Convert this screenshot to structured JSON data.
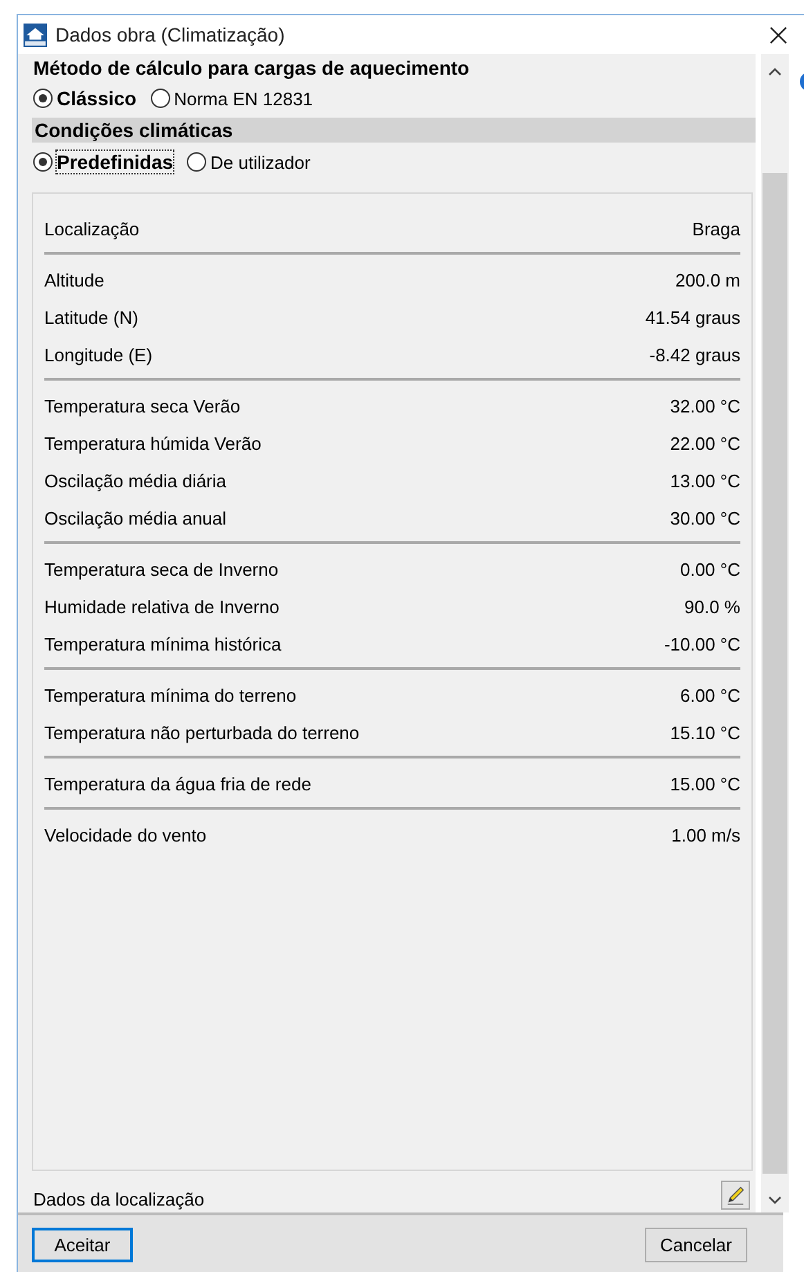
{
  "window": {
    "title": "Dados obra (Climatização)"
  },
  "heating_method": {
    "title": "Método de cálculo para cargas de aquecimento",
    "options": [
      {
        "label": "Clássico",
        "selected": true
      },
      {
        "label": "Norma EN 12831",
        "selected": false
      }
    ]
  },
  "climate": {
    "title": "Condições climáticas",
    "options": [
      {
        "label": "Predefinidas",
        "selected": true
      },
      {
        "label": "De utilizador",
        "selected": false
      }
    ]
  },
  "groups": [
    {
      "rows": [
        {
          "label": "Localização",
          "value": "Braga"
        }
      ]
    },
    {
      "rows": [
        {
          "label": "Altitude",
          "value": "200.0 m"
        },
        {
          "label": "Latitude (N)",
          "value": "41.54 graus"
        },
        {
          "label": "Longitude (E)",
          "value": "-8.42 graus"
        }
      ]
    },
    {
      "rows": [
        {
          "label": "Temperatura seca Verão",
          "value": "32.00 °C"
        },
        {
          "label": "Temperatura húmida Verão",
          "value": "22.00 °C"
        },
        {
          "label": "Oscilação média diária",
          "value": "13.00 °C"
        },
        {
          "label": "Oscilação média anual",
          "value": "30.00 °C"
        }
      ]
    },
    {
      "rows": [
        {
          "label": "Temperatura seca de Inverno",
          "value": "0.00 °C"
        },
        {
          "label": "Humidade relativa de Inverno",
          "value": "90.0 %"
        },
        {
          "label": "Temperatura mínima histórica",
          "value": "-10.00 °C"
        }
      ]
    },
    {
      "rows": [
        {
          "label": "Temperatura mínima do terreno",
          "value": "6.00 °C"
        },
        {
          "label": "Temperatura não perturbada do terreno",
          "value": "15.10 °C"
        }
      ]
    },
    {
      "rows": [
        {
          "label": "Temperatura da água fria de rede",
          "value": "15.00 °C"
        }
      ]
    },
    {
      "rows": [
        {
          "label": "Velocidade do vento",
          "value": "1.00 m/s"
        }
      ]
    }
  ],
  "location_data": {
    "label": "Dados da localização"
  },
  "buttons": [
    {
      "label": "Aceitar",
      "default": true
    },
    {
      "label": "Cancelar",
      "default": false
    }
  ]
}
